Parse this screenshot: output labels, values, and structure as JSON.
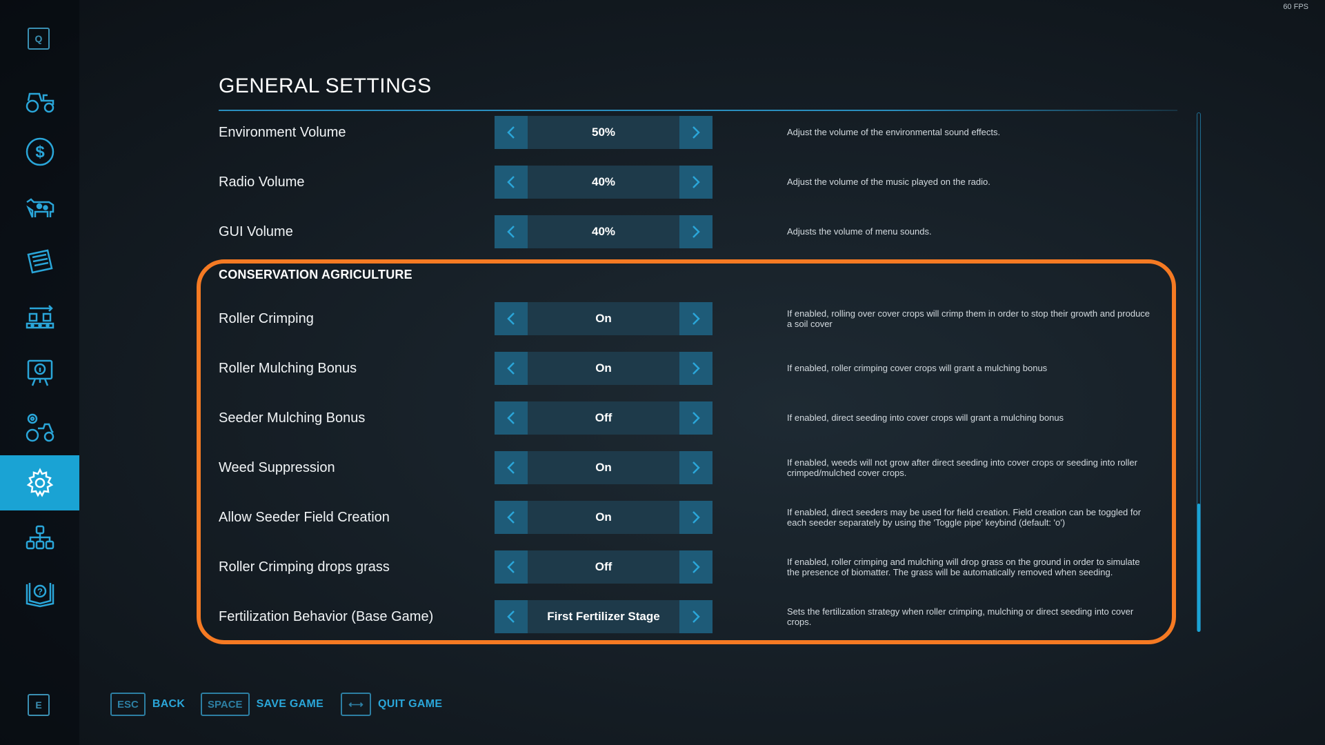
{
  "fps": "60 FPS",
  "sidebar": {
    "top_key": "Q",
    "bottom_key": "E",
    "items": [
      {
        "icon": "tractor-icon"
      },
      {
        "icon": "dollar-icon"
      },
      {
        "icon": "cow-icon"
      },
      {
        "icon": "contracts-icon"
      },
      {
        "icon": "production-chain-icon"
      },
      {
        "icon": "tutorial-board-icon"
      },
      {
        "icon": "vehicle-settings-icon"
      },
      {
        "icon": "gear-icon",
        "active": true
      },
      {
        "icon": "hierarchy-icon"
      },
      {
        "icon": "help-book-icon"
      }
    ]
  },
  "page_title": "GENERAL SETTINGS",
  "settings_top": [
    {
      "label": "Environment Volume",
      "value": "50%",
      "desc": "Adjust the volume of the environmental sound effects."
    },
    {
      "label": "Radio Volume",
      "value": "40%",
      "desc": "Adjust the volume of the music played on the radio."
    },
    {
      "label": "GUI Volume",
      "value": "40%",
      "desc": "Adjusts the volume of menu sounds."
    }
  ],
  "section_title": "CONSERVATION AGRICULTURE",
  "settings_section": [
    {
      "label": "Roller Crimping",
      "value": "On",
      "desc": "If enabled, rolling over cover crops will crimp them in order to stop their growth and produce a soil cover"
    },
    {
      "label": "Roller Mulching Bonus",
      "value": "On",
      "desc": "If enabled, roller crimping cover crops will grant a mulching bonus"
    },
    {
      "label": "Seeder Mulching Bonus",
      "value": "Off",
      "desc": "If enabled, direct seeding into cover crops will grant a mulching bonus"
    },
    {
      "label": "Weed Suppression",
      "value": "On",
      "desc": "If enabled, weeds will not grow after direct seeding into cover crops or seeding into roller crimped/mulched cover crops."
    },
    {
      "label": "Allow Seeder Field Creation",
      "value": "On",
      "desc": "If enabled, direct seeders may be used for field creation. Field creation can be toggled for each seeder separately by using the 'Toggle pipe' keybind (default: 'o')"
    },
    {
      "label": "Roller Crimping drops grass",
      "value": "Off",
      "desc": "If enabled, roller crimping and mulching will drop grass on the ground in order to simulate the presence of biomatter. The grass will be automatically removed when seeding."
    },
    {
      "label": "Fertilization Behavior (Base Game)",
      "value": "First Fertilizer Stage",
      "desc": "Sets the fertilization strategy when roller crimping, mulching or direct seeding into cover crops."
    }
  ],
  "footer": {
    "back": {
      "key": "ESC",
      "label": "BACK"
    },
    "save": {
      "key": "SPACE",
      "label": "SAVE GAME"
    },
    "quit": {
      "key": "⟷",
      "label": "QUIT GAME"
    }
  },
  "colors": {
    "accent": "#1aa3d4",
    "highlight": "#f57a23",
    "arrow_bg": "#1e5b78",
    "value_bg": "#1e3a4a"
  }
}
